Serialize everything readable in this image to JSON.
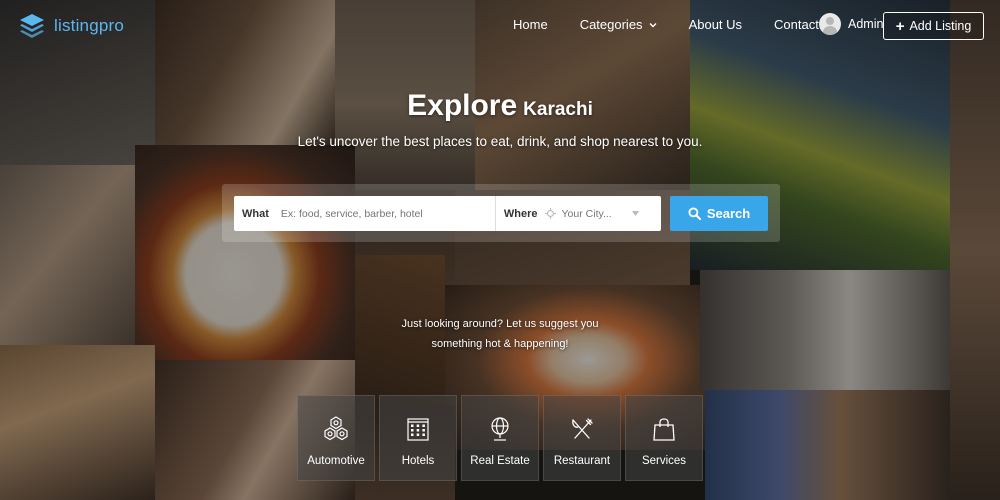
{
  "brand": {
    "name": "listingpro",
    "accent": "#5bb7f0"
  },
  "nav": {
    "items": [
      {
        "label": "Home"
      },
      {
        "label": "Categories"
      },
      {
        "label": "About Us"
      },
      {
        "label": "Contact"
      }
    ]
  },
  "user": {
    "name": "Admin"
  },
  "add_listing_label": "Add Listing",
  "hero": {
    "title": "Explore",
    "city": "Karachi",
    "subtitle": "Let's uncover the best places to eat, drink, and shop nearest to you."
  },
  "search": {
    "what_label": "What",
    "what_placeholder": "Ex: food, service, barber, hotel",
    "where_label": "Where",
    "where_placeholder": "Your City...",
    "button_label": "Search",
    "button_color": "#3aa6ea"
  },
  "suggest": {
    "line1": "Just looking around? Let us suggest you",
    "line2": "something hot & happening!"
  },
  "categories": [
    {
      "label": "Automotive",
      "icon": "hexagons-icon"
    },
    {
      "label": "Hotels",
      "icon": "building-icon"
    },
    {
      "label": "Real Estate",
      "icon": "globe-icon"
    },
    {
      "label": "Restaurant",
      "icon": "utensils-icon"
    },
    {
      "label": "Services",
      "icon": "shopping-bag-icon"
    }
  ]
}
